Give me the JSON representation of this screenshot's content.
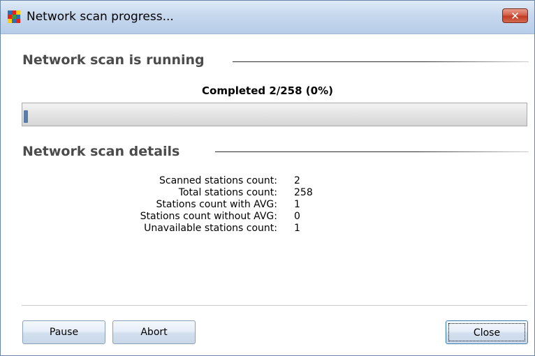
{
  "window": {
    "title": "Network scan progress...",
    "close_glyph": "✕",
    "icon": "avg-logo-icon"
  },
  "scan": {
    "heading": "Network scan is running",
    "status": "Completed 2/258 (0%)",
    "progress_fraction": 0.0078
  },
  "details": {
    "heading": "Network scan details",
    "rows": [
      {
        "label": "Scanned stations count:",
        "value": "2"
      },
      {
        "label": "Total stations count:",
        "value": "258"
      },
      {
        "label": "Stations count with AVG:",
        "value": "1"
      },
      {
        "label": "Stations count without AVG:",
        "value": "0"
      },
      {
        "label": "Unavailable stations count:",
        "value": "1"
      }
    ]
  },
  "buttons": {
    "pause": "Pause",
    "abort": "Abort",
    "close": "Close"
  }
}
